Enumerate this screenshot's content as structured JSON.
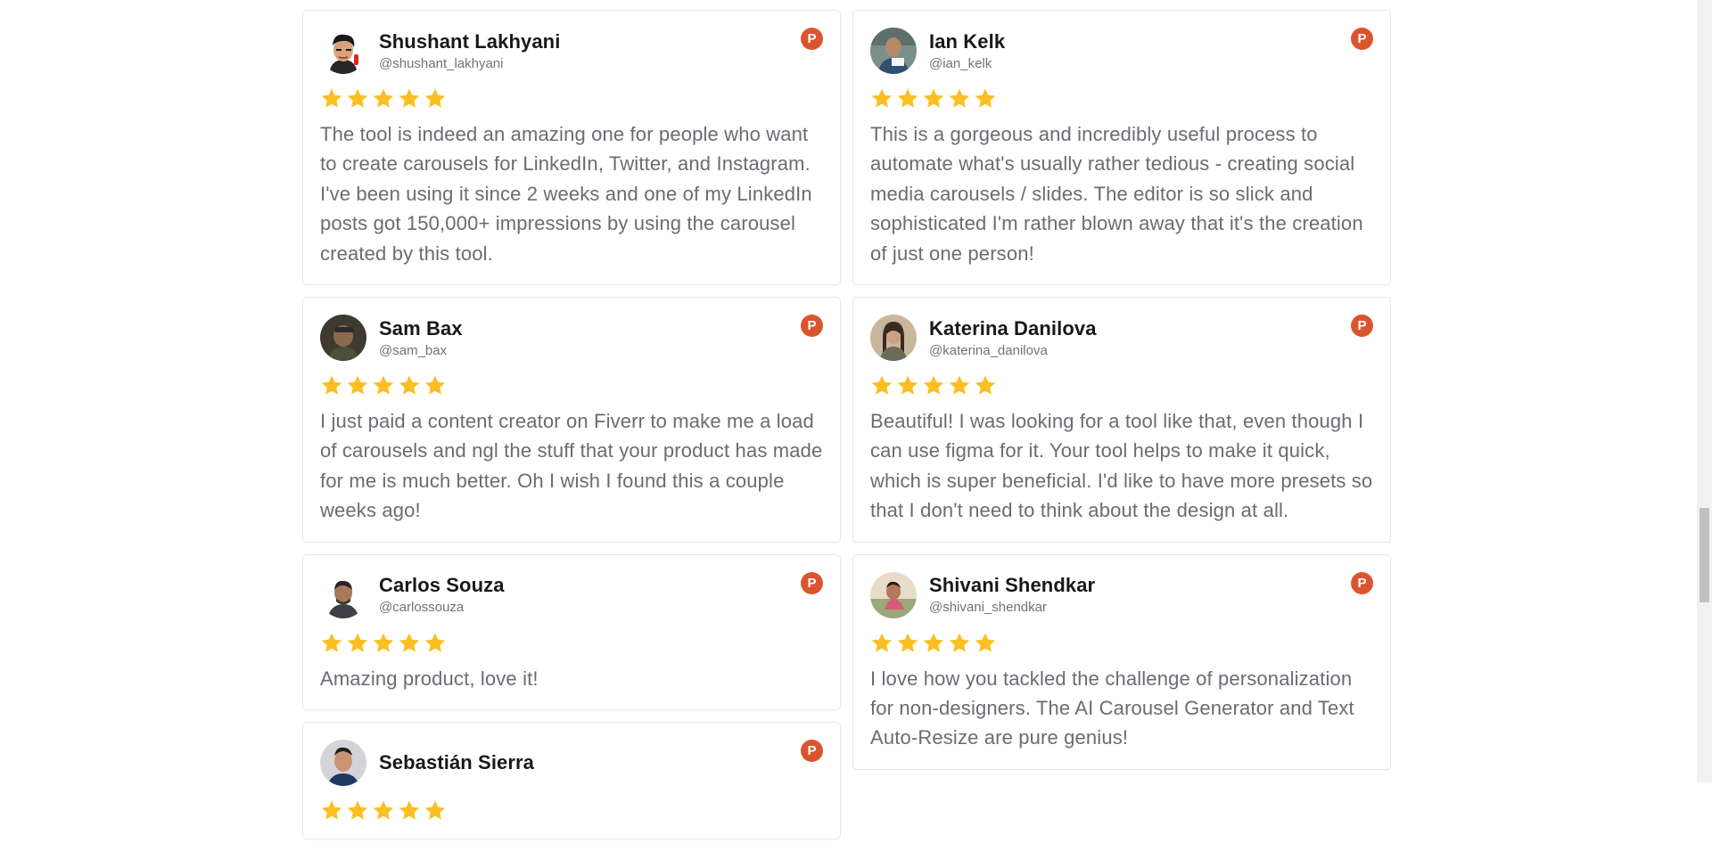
{
  "colors": {
    "star": "#fbbf24",
    "product_hunt": "#da552f",
    "card_border": "#e5e7eb",
    "body_text": "#6b6b73",
    "handle_text": "#71717a"
  },
  "badge_letter": "P",
  "reviews_left": [
    {
      "name": "Shushant Lakhyani",
      "handle": "@shushant_lakhyani",
      "rating": 5,
      "text": "The tool is indeed an amazing one for people who want to create carousels for LinkedIn, Twitter, and Instagram. I've been using it since 2 weeks and one of my LinkedIn posts got 150,000+ impressions by using the carousel created by this tool.",
      "avatar_icon": "cartoon-avatar-icon"
    },
    {
      "name": "Sam Bax",
      "handle": "@sam_bax",
      "rating": 5,
      "text": "I just paid a content creator on Fiverr to make me a load of carousels and ngl the stuff that your product has made for me is much better. Oh I wish I found this a couple weeks ago!",
      "avatar_icon": "photo-avatar-icon"
    },
    {
      "name": "Carlos Souza",
      "handle": "@carlossouza",
      "rating": 5,
      "text": "Amazing product, love it!",
      "avatar_icon": "photo-avatar-icon"
    },
    {
      "name": "Sebastián Sierra",
      "handle": "",
      "rating": 5,
      "text": "",
      "avatar_icon": "photo-avatar-icon"
    }
  ],
  "reviews_right": [
    {
      "name": "Ian Kelk",
      "handle": "@ian_kelk",
      "rating": 5,
      "text": "This is a gorgeous and incredibly useful process to automate what's usually rather tedious - creating social media carousels / slides. The editor is so slick and sophisticated I'm rather blown away that it's the creation of just one person!",
      "avatar_icon": "photo-avatar-icon"
    },
    {
      "name": "Katerina Danilova",
      "handle": "@katerina_danilova",
      "rating": 5,
      "text": "Beautiful! I was looking for a tool like that, even though I can use figma for it. Your tool helps to make it quick, which is super beneficial. I'd like to have more presets so that I don't need to think about the design at all.",
      "avatar_icon": "photo-avatar-icon"
    },
    {
      "name": "Shivani Shendkar",
      "handle": "@shivani_shendkar",
      "rating": 5,
      "text": "I love how you tackled the challenge of personalization for non-designers. The AI Carousel Generator and Text Auto-Resize are pure genius!",
      "avatar_icon": "photo-avatar-icon"
    }
  ]
}
